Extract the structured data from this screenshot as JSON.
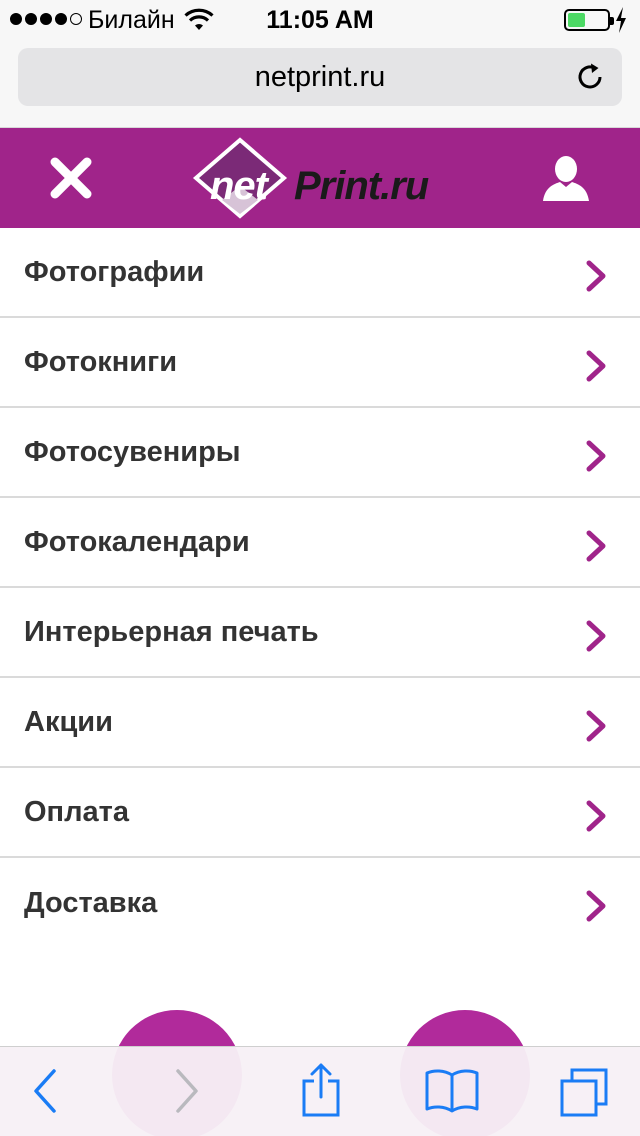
{
  "status_bar": {
    "carrier": "Билайн",
    "time": "11:05 AM",
    "signal_bars_filled": 4,
    "signal_bars_total": 5,
    "battery_level": 0.45,
    "battery_color": "#4cd964"
  },
  "browser": {
    "url": "netprint.ru",
    "icons": {
      "reload": "reload-icon",
      "back": "chevron-left-icon",
      "forward": "chevron-right-icon",
      "share": "share-icon",
      "bookmarks": "book-icon",
      "tabs": "tabs-icon"
    },
    "accent_color": "#1a7cf5"
  },
  "header": {
    "logo_net": "net",
    "logo_print": "Print.ru",
    "close_icon": "close-icon",
    "user_icon": "user-icon",
    "brand_color": "#a0248a"
  },
  "menu": {
    "items": [
      {
        "label": "Фотографии"
      },
      {
        "label": "Фотокниги"
      },
      {
        "label": "Фотосувениры"
      },
      {
        "label": "Фотокалендари"
      },
      {
        "label": "Интерьерная печать"
      },
      {
        "label": "Акции"
      },
      {
        "label": "Оплата"
      },
      {
        "label": "Доставка"
      }
    ],
    "chevron_color": "#a0248a"
  }
}
